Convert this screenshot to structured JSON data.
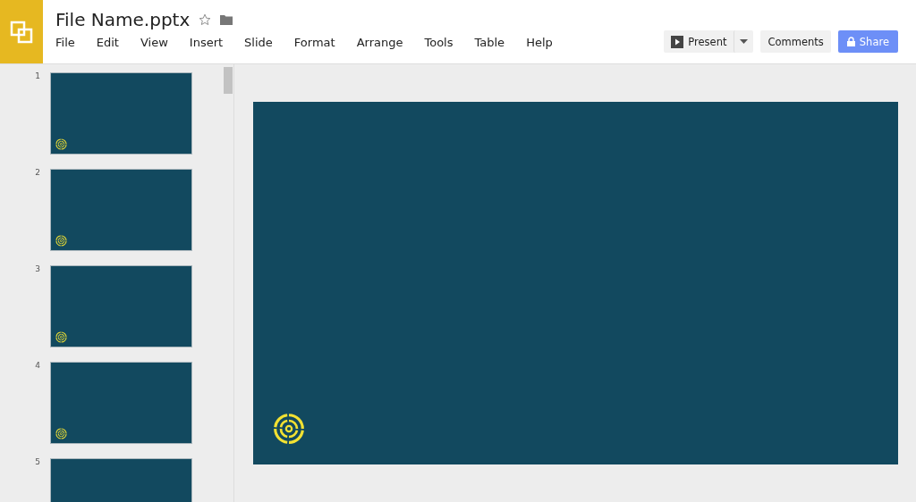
{
  "document": {
    "title": "File Name.pptx",
    "starred": false
  },
  "menu": [
    "File",
    "Edit",
    "View",
    "Insert",
    "Slide",
    "Format",
    "Arrange",
    "Tools",
    "Table",
    "Help"
  ],
  "actions": {
    "present": "Present",
    "comments": "Comments",
    "share": "Share"
  },
  "slides": [
    {
      "number": "1",
      "selected": false
    },
    {
      "number": "2",
      "selected": false
    },
    {
      "number": "3",
      "selected": false
    },
    {
      "number": "4",
      "selected": false
    },
    {
      "number": "5",
      "selected": false
    }
  ]
}
